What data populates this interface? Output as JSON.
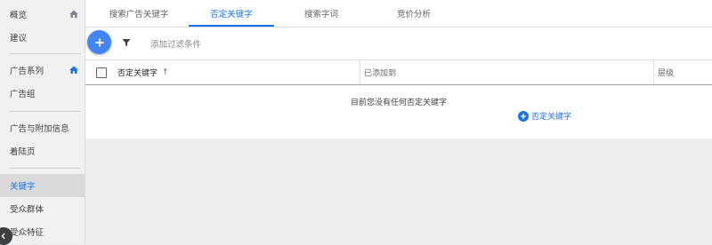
{
  "sidebar": {
    "items": [
      {
        "label": "概览",
        "icon": "home-icon"
      },
      {
        "label": "建议"
      },
      {
        "label": "广告系列",
        "icon": "home-icon"
      },
      {
        "label": "广告组"
      },
      {
        "label": "广告与附加信息"
      },
      {
        "label": "着陆页"
      },
      {
        "label": "关键字"
      },
      {
        "label": "受众群体"
      },
      {
        "label": "受众特征"
      }
    ]
  },
  "tabs": [
    "搜索广告关键字",
    "否定关键字",
    "搜索字词",
    "竞价分析"
  ],
  "toolbar": {
    "filter_label": "添加过滤条件"
  },
  "table": {
    "columns": [
      "否定关键字",
      "已添加到",
      "层级"
    ],
    "sort_indicator": "↑",
    "empty_message": "目前您没有任何否定关键字",
    "empty_action": "否定关键字"
  },
  "colors": {
    "accent": "#1a73e8",
    "fab": "#4285f4"
  }
}
